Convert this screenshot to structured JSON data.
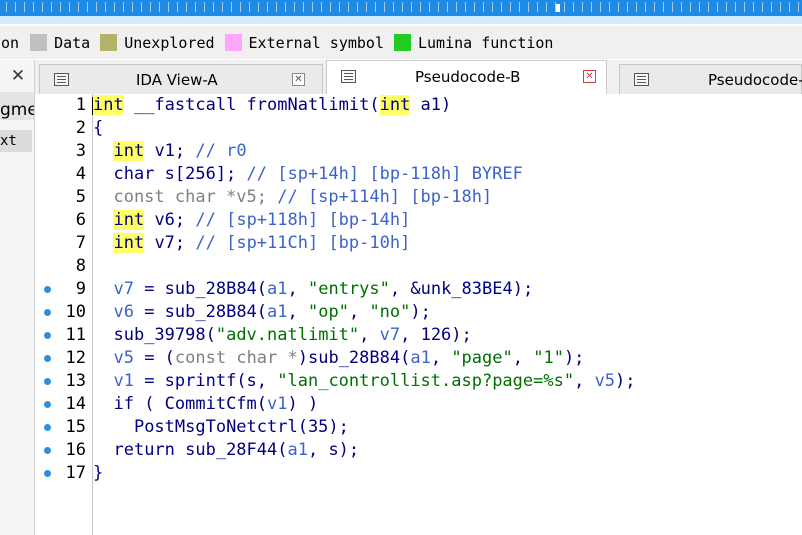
{
  "legend": {
    "items": [
      {
        "label": "ion",
        "color": ""
      },
      {
        "label": "Data",
        "color": "#c0c0c0"
      },
      {
        "label": "Unexplored",
        "color": "#b5b26b"
      },
      {
        "label": "External symbol",
        "color": "#ffa6ff"
      },
      {
        "label": "Lumina function",
        "color": "#22cc22"
      }
    ]
  },
  "left_panel": {
    "close": "✕",
    "segment_text": "gme",
    "ext_text": "xt"
  },
  "tabs": [
    {
      "label": "IDA View-A",
      "close": "✕",
      "active": false
    },
    {
      "label": "Pseudocode-B",
      "close": "✕",
      "active": true
    },
    {
      "label": "Pseudocode-",
      "close": "",
      "active": false
    }
  ],
  "code": {
    "line_numbers": [
      "1",
      "2",
      "3",
      "4",
      "5",
      "6",
      "7",
      "8",
      "9",
      "10",
      "11",
      "12",
      "13",
      "14",
      "15",
      "16",
      "17"
    ],
    "l1": {
      "kw": "int",
      "a": " __fastcall fromNatlimit(",
      "kw2": "int",
      "b": " a1)"
    },
    "l2": "{",
    "l3": {
      "kw": "int",
      "a": " v1; ",
      "c": "// r0"
    },
    "l4": {
      "a": "  char s[256]; ",
      "c": "// [sp+14h] [bp-118h] BYREF"
    },
    "l5": {
      "g": "  const char *v5; ",
      "c": "// [sp+114h] [bp-18h]"
    },
    "l6": {
      "kw": "int",
      "a": " v6; ",
      "c": "// [sp+118h] [bp-14h]"
    },
    "l7": {
      "kw": "int",
      "a": " v7; ",
      "c": "// [sp+11Ch] [bp-10h]"
    },
    "l9": {
      "v": "v7",
      "a": " = sub_28B84(",
      "p": "a1",
      "b": ", ",
      "s1": "\"entrys\"",
      "c": ", &unk_83BE4);"
    },
    "l10": {
      "v": "v6",
      "a": " = sub_28B84(",
      "p": "a1",
      "b": ", ",
      "s1": "\"op\"",
      "c": ", ",
      "s2": "\"no\"",
      "d": ");"
    },
    "l11": {
      "a": "sub_39798(",
      "s1": "\"adv.natlimit\"",
      "b": ", ",
      "v": "v7",
      "c": ", 126);"
    },
    "l12": {
      "v": "v5",
      "a": " = (",
      "g": "const char *",
      "b": ")sub_28B84(",
      "p": "a1",
      "c": ", ",
      "s1": "\"page\"",
      "d": ", ",
      "s2": "\"1\"",
      "e": ");"
    },
    "l13": {
      "v": "v1",
      "a": " = sprintf(s, ",
      "s1": "\"lan_controllist.asp?page=%s\"",
      "b": ", ",
      "v2": "v5",
      "c": ");"
    },
    "l14": {
      "a": "if ( CommitCfm(",
      "v": "v1",
      "b": ") )"
    },
    "l15": {
      "a": "PostMsgToNetctrl(35);"
    },
    "l16": {
      "a": "return sub_28F44(",
      "p": "a1",
      "b": ", s);"
    },
    "l17": "}"
  }
}
